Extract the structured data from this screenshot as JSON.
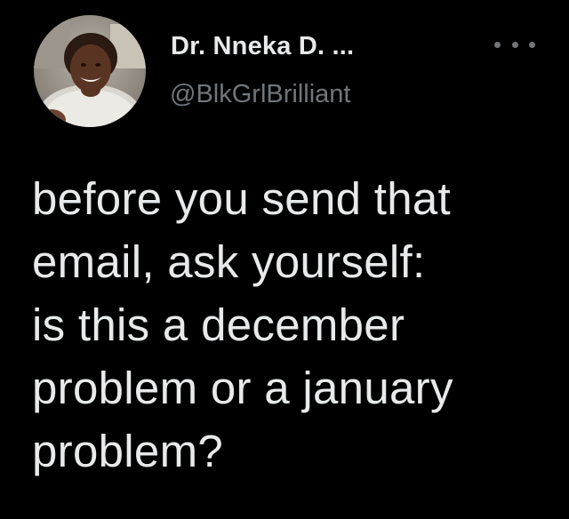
{
  "colors": {
    "background": "#000000",
    "primary_text": "#e7e9ea",
    "secondary_text": "#71767b"
  },
  "author": {
    "display_name": "Dr. Nneka D. ...",
    "handle": "@BlkGrlBrilliant",
    "avatar_icon": "profile-photo"
  },
  "actions": {
    "more_icon": "more-horizontal-icon"
  },
  "tweet": {
    "lines": [
      "before you send that",
      "email, ask yourself:",
      "is this a december",
      "problem or a january",
      "problem?"
    ]
  }
}
